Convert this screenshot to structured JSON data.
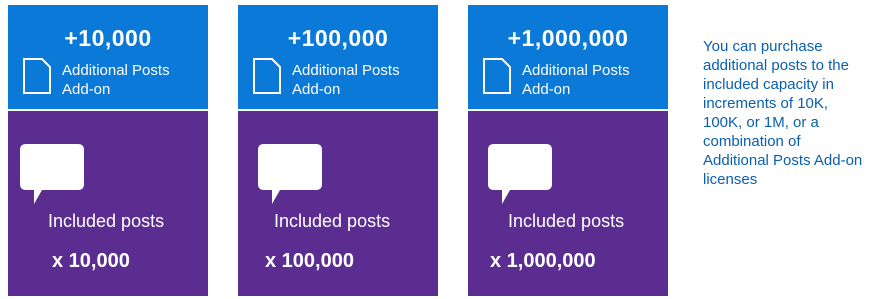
{
  "colors": {
    "addon_blue": "#0a79d8",
    "included_purple": "#5c2d91",
    "note_text": "#0a5fb0"
  },
  "cards": [
    {
      "addon_amount": "+10,000",
      "addon_label_line1": "Additional Posts",
      "addon_label_line2": "Add-on",
      "included_label": "Included posts",
      "included_count": "x 10,000"
    },
    {
      "addon_amount": "+100,000",
      "addon_label_line1": "Additional Posts",
      "addon_label_line2": "Add-on",
      "included_label": "Included posts",
      "included_count": "x 100,000"
    },
    {
      "addon_amount": "+1,000,000",
      "addon_label_line1": "Additional Posts",
      "addon_label_line2": "Add-on",
      "included_label": "Included posts",
      "included_count": "x 1,000,000"
    }
  ],
  "icons": {
    "addon": "document-icon",
    "included": "speech-bubble-icon"
  },
  "side_note": "You can purchase additional posts to the included capacity in increments of 10K, 100K, or 1M, or a combination of Additional Posts Add-on licenses"
}
